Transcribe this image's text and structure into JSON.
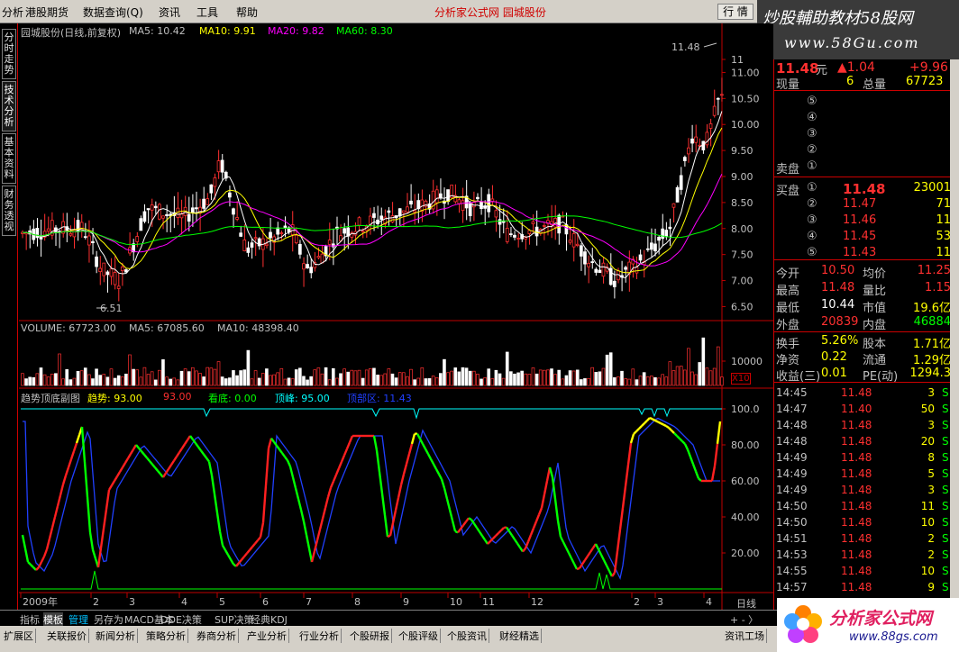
{
  "menu": {
    "items": [
      "分析",
      "港股期货",
      "数据查询(Q)",
      "资讯",
      "工具",
      "帮助"
    ],
    "app_title": "分析家公式网 园城股份",
    "back_button": "行 情"
  },
  "brand": {
    "line1": "炒股輔助教材58股网",
    "line2": "www.58Gu.com"
  },
  "left_tabs": [
    "分时走势",
    "技术分析",
    "基本资料",
    "财务透视"
  ],
  "price_panel": {
    "title": "园城股份(日线,前复权)",
    "ma5": "MA5: 10.42",
    "ma10": "MA10: 9.91",
    "ma20": "MA20: 9.82",
    "ma60": "MA60: 8.30",
    "high_mark": "11.48",
    "low_mark": "6.51",
    "yticks": [
      "11",
      "11.00",
      "10.50",
      "10.00",
      "9.50",
      "9.00",
      "8.50",
      "8.00",
      "7.50",
      "7.00",
      "6.50"
    ]
  },
  "volume_panel": {
    "vol": "VOLUME: 67723.00",
    "ma5": "MA5: 67085.60",
    "ma10": "MA10: 48398.40",
    "ytick": "10000",
    "unit": "X10"
  },
  "indicator_panel": {
    "title": "趋势顶底副图",
    "trend": "趋势: 93.00",
    "val2": "93.00",
    "bottom": "看底: 0.00",
    "top": "顶峰: 95.00",
    "peak": "顶部区: 11.43",
    "yticks": [
      "100.0",
      "80.00",
      "60.00",
      "40.00",
      "20.00"
    ]
  },
  "x_axis": {
    "labels": [
      "2009年",
      "2",
      "3",
      "4",
      "5",
      "6",
      "7",
      "8",
      "9",
      "10",
      "11",
      "12",
      "2",
      "3",
      "4"
    ],
    "period": "日线"
  },
  "quote": {
    "price": "11.48",
    "unit": "元",
    "change": "▲1.04",
    "change_pct": "+9.96",
    "now_vol_label": "现量",
    "now_vol": "6",
    "total_vol_label": "总量",
    "total_vol": "67723",
    "sell_label": "卖盘",
    "sells": [
      {
        "lvl": "⑤",
        "price": "",
        "vol": ""
      },
      {
        "lvl": "④",
        "price": "",
        "vol": ""
      },
      {
        "lvl": "③",
        "price": "",
        "vol": ""
      },
      {
        "lvl": "②",
        "price": "",
        "vol": ""
      },
      {
        "lvl": "①",
        "price": "",
        "vol": ""
      }
    ],
    "buy_label": "买盘",
    "buys": [
      {
        "lvl": "①",
        "price": "11.48",
        "vol": "23001"
      },
      {
        "lvl": "②",
        "price": "11.47",
        "vol": "71"
      },
      {
        "lvl": "③",
        "price": "11.46",
        "vol": "11"
      },
      {
        "lvl": "④",
        "price": "11.45",
        "vol": "53"
      },
      {
        "lvl": "⑤",
        "price": "11.43",
        "vol": "11"
      }
    ],
    "stats": [
      {
        "l1": "今开",
        "v1": "10.50",
        "l2": "均价",
        "v2": "11.25"
      },
      {
        "l1": "最高",
        "v1": "11.48",
        "l2": "量比",
        "v2": "1.15"
      },
      {
        "l1": "最低",
        "v1": "10.44",
        "l2": "市值",
        "v2": "19.6亿"
      },
      {
        "l1": "外盘",
        "v1": "20839",
        "l2": "内盘",
        "v2": "46884"
      }
    ],
    "stats2": [
      {
        "l1": "换手",
        "v1": "5.26%",
        "l2": "股本",
        "v2": "1.71亿"
      },
      {
        "l1": "净资",
        "v1": "0.22",
        "l2": "流通",
        "v2": "1.29亿"
      },
      {
        "l1": "收益(三)",
        "v1": "0.01",
        "l2": "PE(动)",
        "v2": "1294.3"
      }
    ],
    "ticks": [
      {
        "t": "14:45",
        "p": "11.48",
        "v": "3",
        "s": "S"
      },
      {
        "t": "14:47",
        "p": "11.40",
        "v": "50",
        "s": "S"
      },
      {
        "t": "14:48",
        "p": "11.48",
        "v": "3",
        "s": "S"
      },
      {
        "t": "14:48",
        "p": "11.48",
        "v": "20",
        "s": "S"
      },
      {
        "t": "14:49",
        "p": "11.48",
        "v": "8",
        "s": "S"
      },
      {
        "t": "14:49",
        "p": "11.48",
        "v": "5",
        "s": "S"
      },
      {
        "t": "14:49",
        "p": "11.48",
        "v": "3",
        "s": "S"
      },
      {
        "t": "14:50",
        "p": "11.48",
        "v": "11",
        "s": "S"
      },
      {
        "t": "14:50",
        "p": "11.48",
        "v": "10",
        "s": "S"
      },
      {
        "t": "14:51",
        "p": "11.48",
        "v": "2",
        "s": "S"
      },
      {
        "t": "14:53",
        "p": "11.48",
        "v": "2",
        "s": "S"
      },
      {
        "t": "14:55",
        "p": "11.48",
        "v": "10",
        "s": "S"
      },
      {
        "t": "14:57",
        "p": "11.48",
        "v": "9",
        "s": "S"
      }
    ]
  },
  "bottom_tabs1": [
    "指标",
    "模板",
    "管理",
    "另存为",
    "MACD基本",
    "DDE决策",
    "SUP决策",
    "经典KDJ"
  ],
  "bottom_tabs2": [
    "扩展区",
    "关联报价",
    "新闻分析",
    "策略分析",
    "券商分析",
    "产业分析",
    "行业分析",
    "个股研报",
    "个股评级",
    "个股资讯",
    "财经精选"
  ],
  "footer": {
    "zoom_controls": "+ - 〉",
    "info": "资讯工场",
    "logo_text": "分析家公式网",
    "logo_url": "www.88gs.com"
  },
  "chart_data": [
    {
      "type": "candlestick",
      "title": "园城股份(日线,前复权)",
      "ylim": [
        6.3,
        11.7
      ],
      "x": [
        "2009-01",
        "2009-02",
        "2009-03",
        "2009-04",
        "2009-05",
        "2009-06",
        "2009-07",
        "2009-08",
        "2009-09",
        "2009-10",
        "2009-11",
        "2009-12",
        "2010-02",
        "2010-03",
        "2010-04"
      ],
      "close_approx": [
        8.0,
        7.2,
        7.9,
        8.3,
        9.0,
        7.6,
        7.6,
        8.2,
        8.6,
        8.4,
        8.3,
        8.1,
        7.8,
        7.0,
        9.5
      ],
      "series": [
        {
          "name": "MA5",
          "last": 10.42,
          "color": "#ffffff"
        },
        {
          "name": "MA10",
          "last": 9.91,
          "color": "#ffff00"
        },
        {
          "name": "MA20",
          "last": 9.82,
          "color": "#ff00ff"
        },
        {
          "name": "MA60",
          "last": 8.3,
          "color": "#00ff00"
        }
      ]
    },
    {
      "type": "bar",
      "title": "VOLUME",
      "last": 67723.0,
      "series": [
        {
          "name": "MA5",
          "last": 67085.6
        },
        {
          "name": "MA10",
          "last": 48398.4
        }
      ]
    },
    {
      "type": "line",
      "title": "趋势顶底副图",
      "ylim": [
        0,
        100
      ],
      "values_approx": [
        25,
        12,
        70,
        40,
        90,
        15,
        25,
        85,
        90,
        30,
        45,
        20,
        65,
        8,
        90,
        60,
        93
      ],
      "series": [
        {
          "name": "趋势",
          "last": 93.0
        }
      ]
    }
  ]
}
